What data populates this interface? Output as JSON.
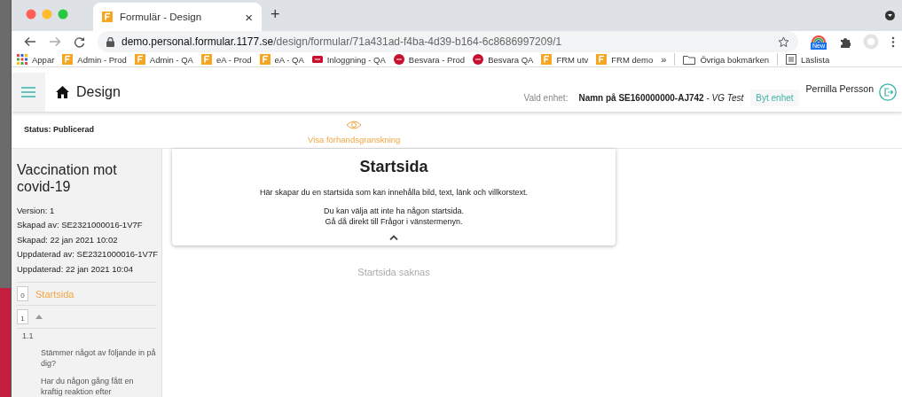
{
  "browser": {
    "tab": {
      "title": "Formulär - Design",
      "close": "×",
      "selected": true
    },
    "new_tab": "+",
    "url": {
      "host": "demo.personal.formular.1177.se",
      "path": "/design/formular/71a431ad-f4ba-4d39-b164-6c8686997209/1"
    },
    "extension_badge": "New",
    "bookmarks": [
      {
        "kind": "apps",
        "label": "Appar"
      },
      {
        "kind": "f",
        "label": "Admin - Prod"
      },
      {
        "kind": "f",
        "label": "Admin - QA"
      },
      {
        "kind": "f",
        "label": "eA - Prod"
      },
      {
        "kind": "f",
        "label": "eA - QA"
      },
      {
        "kind": "login",
        "label": "Inloggning - QA"
      },
      {
        "kind": "besvara",
        "label": "Besvara - Prod"
      },
      {
        "kind": "besvara",
        "label": "Besvara QA"
      },
      {
        "kind": "f",
        "label": "FRM utv"
      },
      {
        "kind": "f",
        "label": "FRM demo"
      }
    ],
    "overflow": "»",
    "other_bookmarks": "Övriga bokmärken",
    "reading_list": "Läslista"
  },
  "header": {
    "title": "Design",
    "unit_label": "Vald enhet:",
    "unit": "**Namn på SE160000000-AJ742** - *VG Test*",
    "change_unit": "Byt enhet",
    "user": "Pernilla Persson"
  },
  "status": "Status: Publicerad",
  "preview": "Visa förhandsgranskning",
  "sidebar": {
    "form_title": "Vaccination mot covid-19",
    "meta": [
      "Version: 1",
      "Skapad av: SE2321000016-1V7F",
      "Skapad: 22 jan 2021 10:02",
      "Uppdaterad av: SE2321000016-1V7F",
      "Uppdaterad: 22 jan 2021 10:04"
    ],
    "pages": [
      {
        "number": "0",
        "label": "Startsida",
        "selected": true
      },
      {
        "number": "1",
        "selected": false,
        "expanded": true,
        "children": [
          {
            "number": "1.1",
            "questions": [
              "Stämmer något av följande in på dig?",
              "Har du någon gång fått en kraftig reaktion efter"
            ]
          }
        ]
      }
    ]
  },
  "card": {
    "title": "Startsida",
    "paragraphs": [
      [
        "Här skapar du en startsida som kan innehålla bild, text, länk och villkorstext."
      ],
      [
        "Du kan välja att inte ha någon startsida.",
        "Gå då direkt till Frågor i vänstermenyn."
      ]
    ]
  },
  "empty_message": "Startsida saknas"
}
